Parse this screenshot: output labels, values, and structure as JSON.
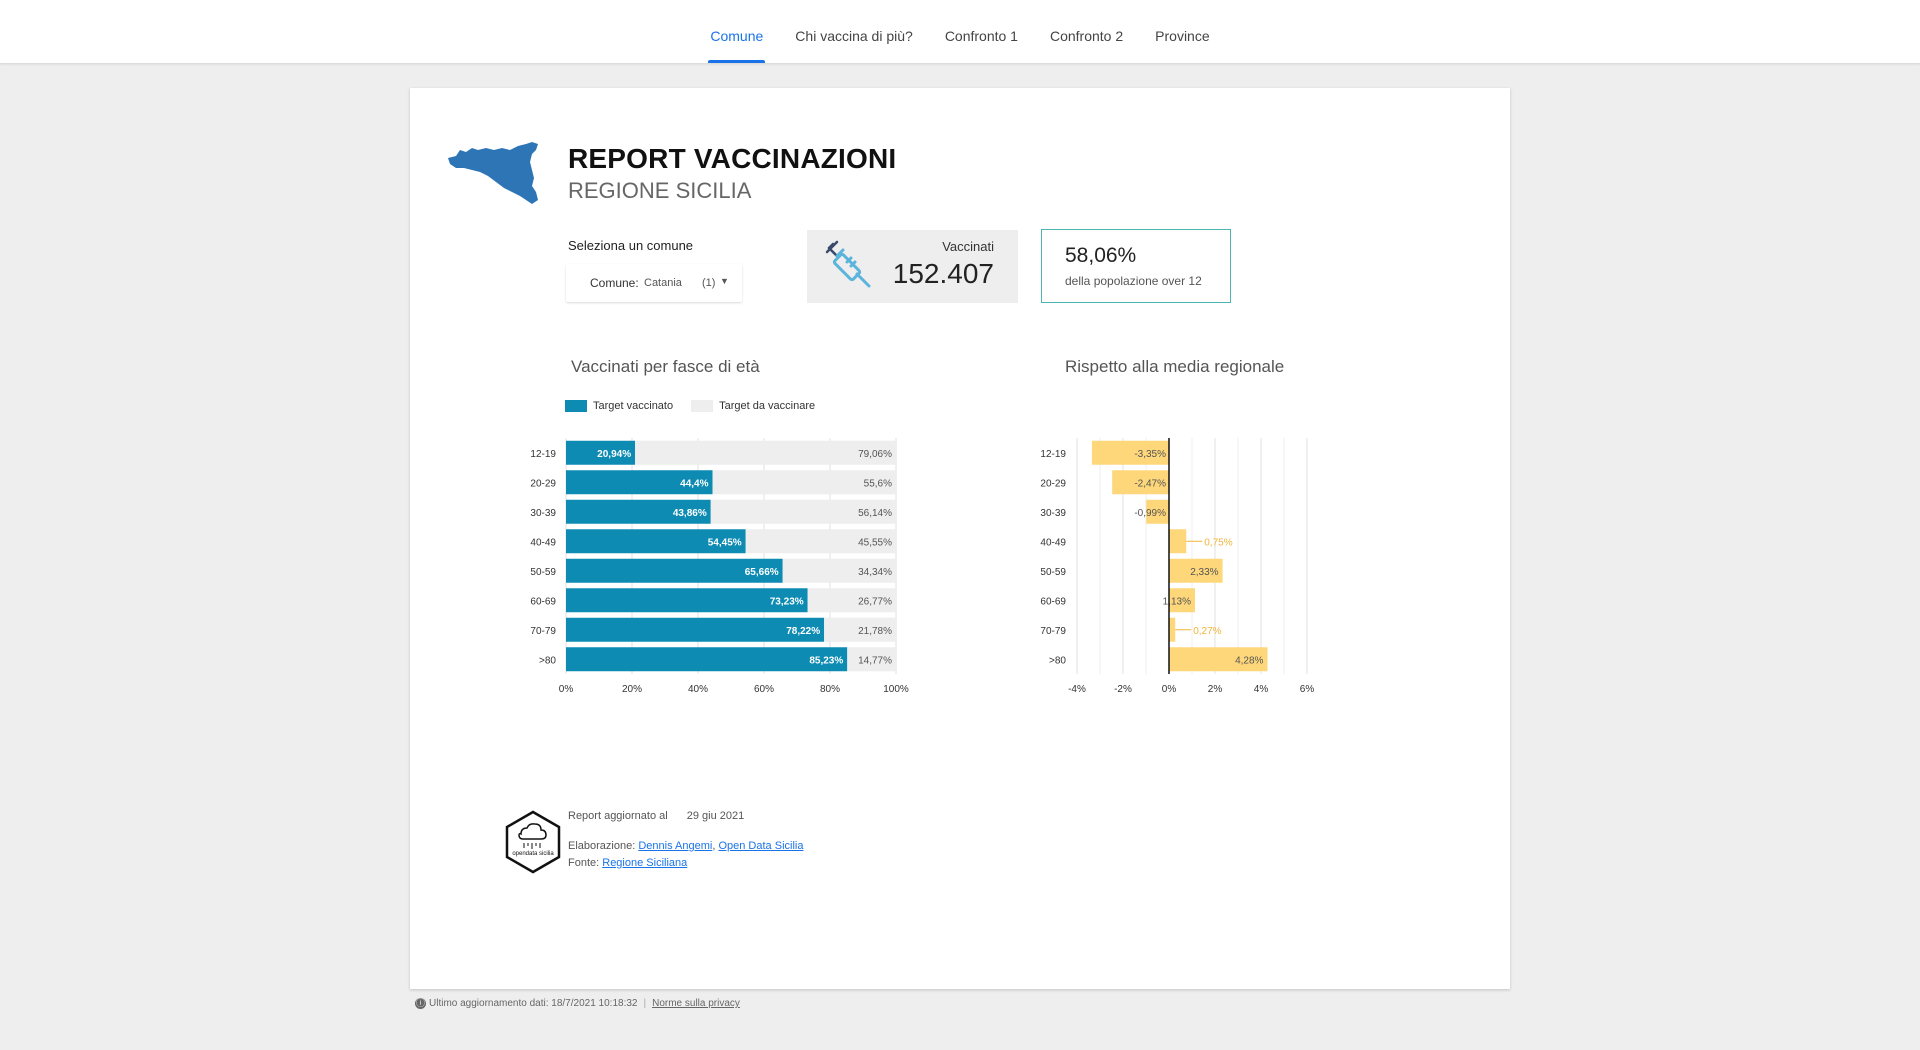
{
  "nav": {
    "tabs": [
      "Comune",
      "Chi vaccina di più?",
      "Confronto 1",
      "Confronto 2",
      "Province"
    ]
  },
  "report": {
    "title": "REPORT VACCINAZIONI",
    "subtitle": "REGIONE SICILIA"
  },
  "selector": {
    "label": "Seleziona un comune",
    "field_label": "Comune:",
    "value": "Catania",
    "count": "(1)"
  },
  "kpi": {
    "vaccinati_label": "Vaccinati",
    "vaccinati_value": "152.407",
    "pct_value": "58,06%",
    "pct_label": "della popolazione over 12"
  },
  "colors": {
    "vaccinated": "#0d8bb3",
    "remaining": "#eeeeee",
    "regional": "#fdd77a",
    "accent": "#1a73e8",
    "map": "#2e75b6"
  },
  "icons": [
    "sicily-map-icon",
    "syringe-icon",
    "opendata-sicilia-logo",
    "info-icon"
  ],
  "chart_data": [
    {
      "type": "bar",
      "orientation": "horizontal",
      "stacked": true,
      "title": "Vaccinati per fasce di età",
      "categories": [
        "12-19",
        "20-29",
        "30-39",
        "40-49",
        "50-59",
        "60-69",
        "70-79",
        ">80"
      ],
      "series": [
        {
          "name": "Target vaccinato",
          "values": [
            20.94,
            44.4,
            43.86,
            54.45,
            65.66,
            73.23,
            78.22,
            85.23
          ],
          "labels": [
            "20,94%",
            "44,4%",
            "43,86%",
            "54,45%",
            "65,66%",
            "73,23%",
            "78,22%",
            "85,23%"
          ]
        },
        {
          "name": "Target da vaccinare",
          "values": [
            79.06,
            55.6,
            56.14,
            45.55,
            34.34,
            26.77,
            21.78,
            14.77
          ],
          "labels": [
            "79,06%",
            "55,6%",
            "56,14%",
            "45,55%",
            "34,34%",
            "26,77%",
            "21,78%",
            "14,77%"
          ]
        }
      ],
      "xlim": [
        0,
        100
      ],
      "xticks": [
        "0%",
        "20%",
        "40%",
        "60%",
        "80%",
        "100%"
      ],
      "legend": "top-left",
      "grid": true
    },
    {
      "type": "bar",
      "orientation": "horizontal",
      "title": "Rispetto alla media regionale",
      "categories": [
        "12-19",
        "20-29",
        "30-39",
        "40-49",
        "50-59",
        "60-69",
        "70-79",
        ">80"
      ],
      "values": [
        -3.35,
        -2.47,
        -0.99,
        0.75,
        2.33,
        1.13,
        0.27,
        4.28
      ],
      "labels": [
        "-3,35%",
        "-2,47%",
        "-0,99%",
        "0,75%",
        "2,33%",
        "1,13%",
        "0,27%",
        "4,28%"
      ],
      "xlim": [
        -4,
        6
      ],
      "xticks": [
        "-4%",
        "-2%",
        "0%",
        "2%",
        "4%",
        "6%"
      ],
      "grid": true
    }
  ],
  "footer": {
    "updated_label": "Report aggiornato al",
    "updated_date": "29 giu 2021",
    "elaborazione_label": "Elaborazione:",
    "author": "Dennis Angemi",
    "comma": ",",
    "org": "Open Data Sicilia",
    "fonte_label": "Fonte:",
    "source": "Regione Siciliana",
    "logo_text": "opendata sicilia"
  },
  "bottom": {
    "last_update": "Ultimo aggiornamento dati: 18/7/2021 10:18:32",
    "sep": "|",
    "privacy": "Norme sulla privacy"
  }
}
